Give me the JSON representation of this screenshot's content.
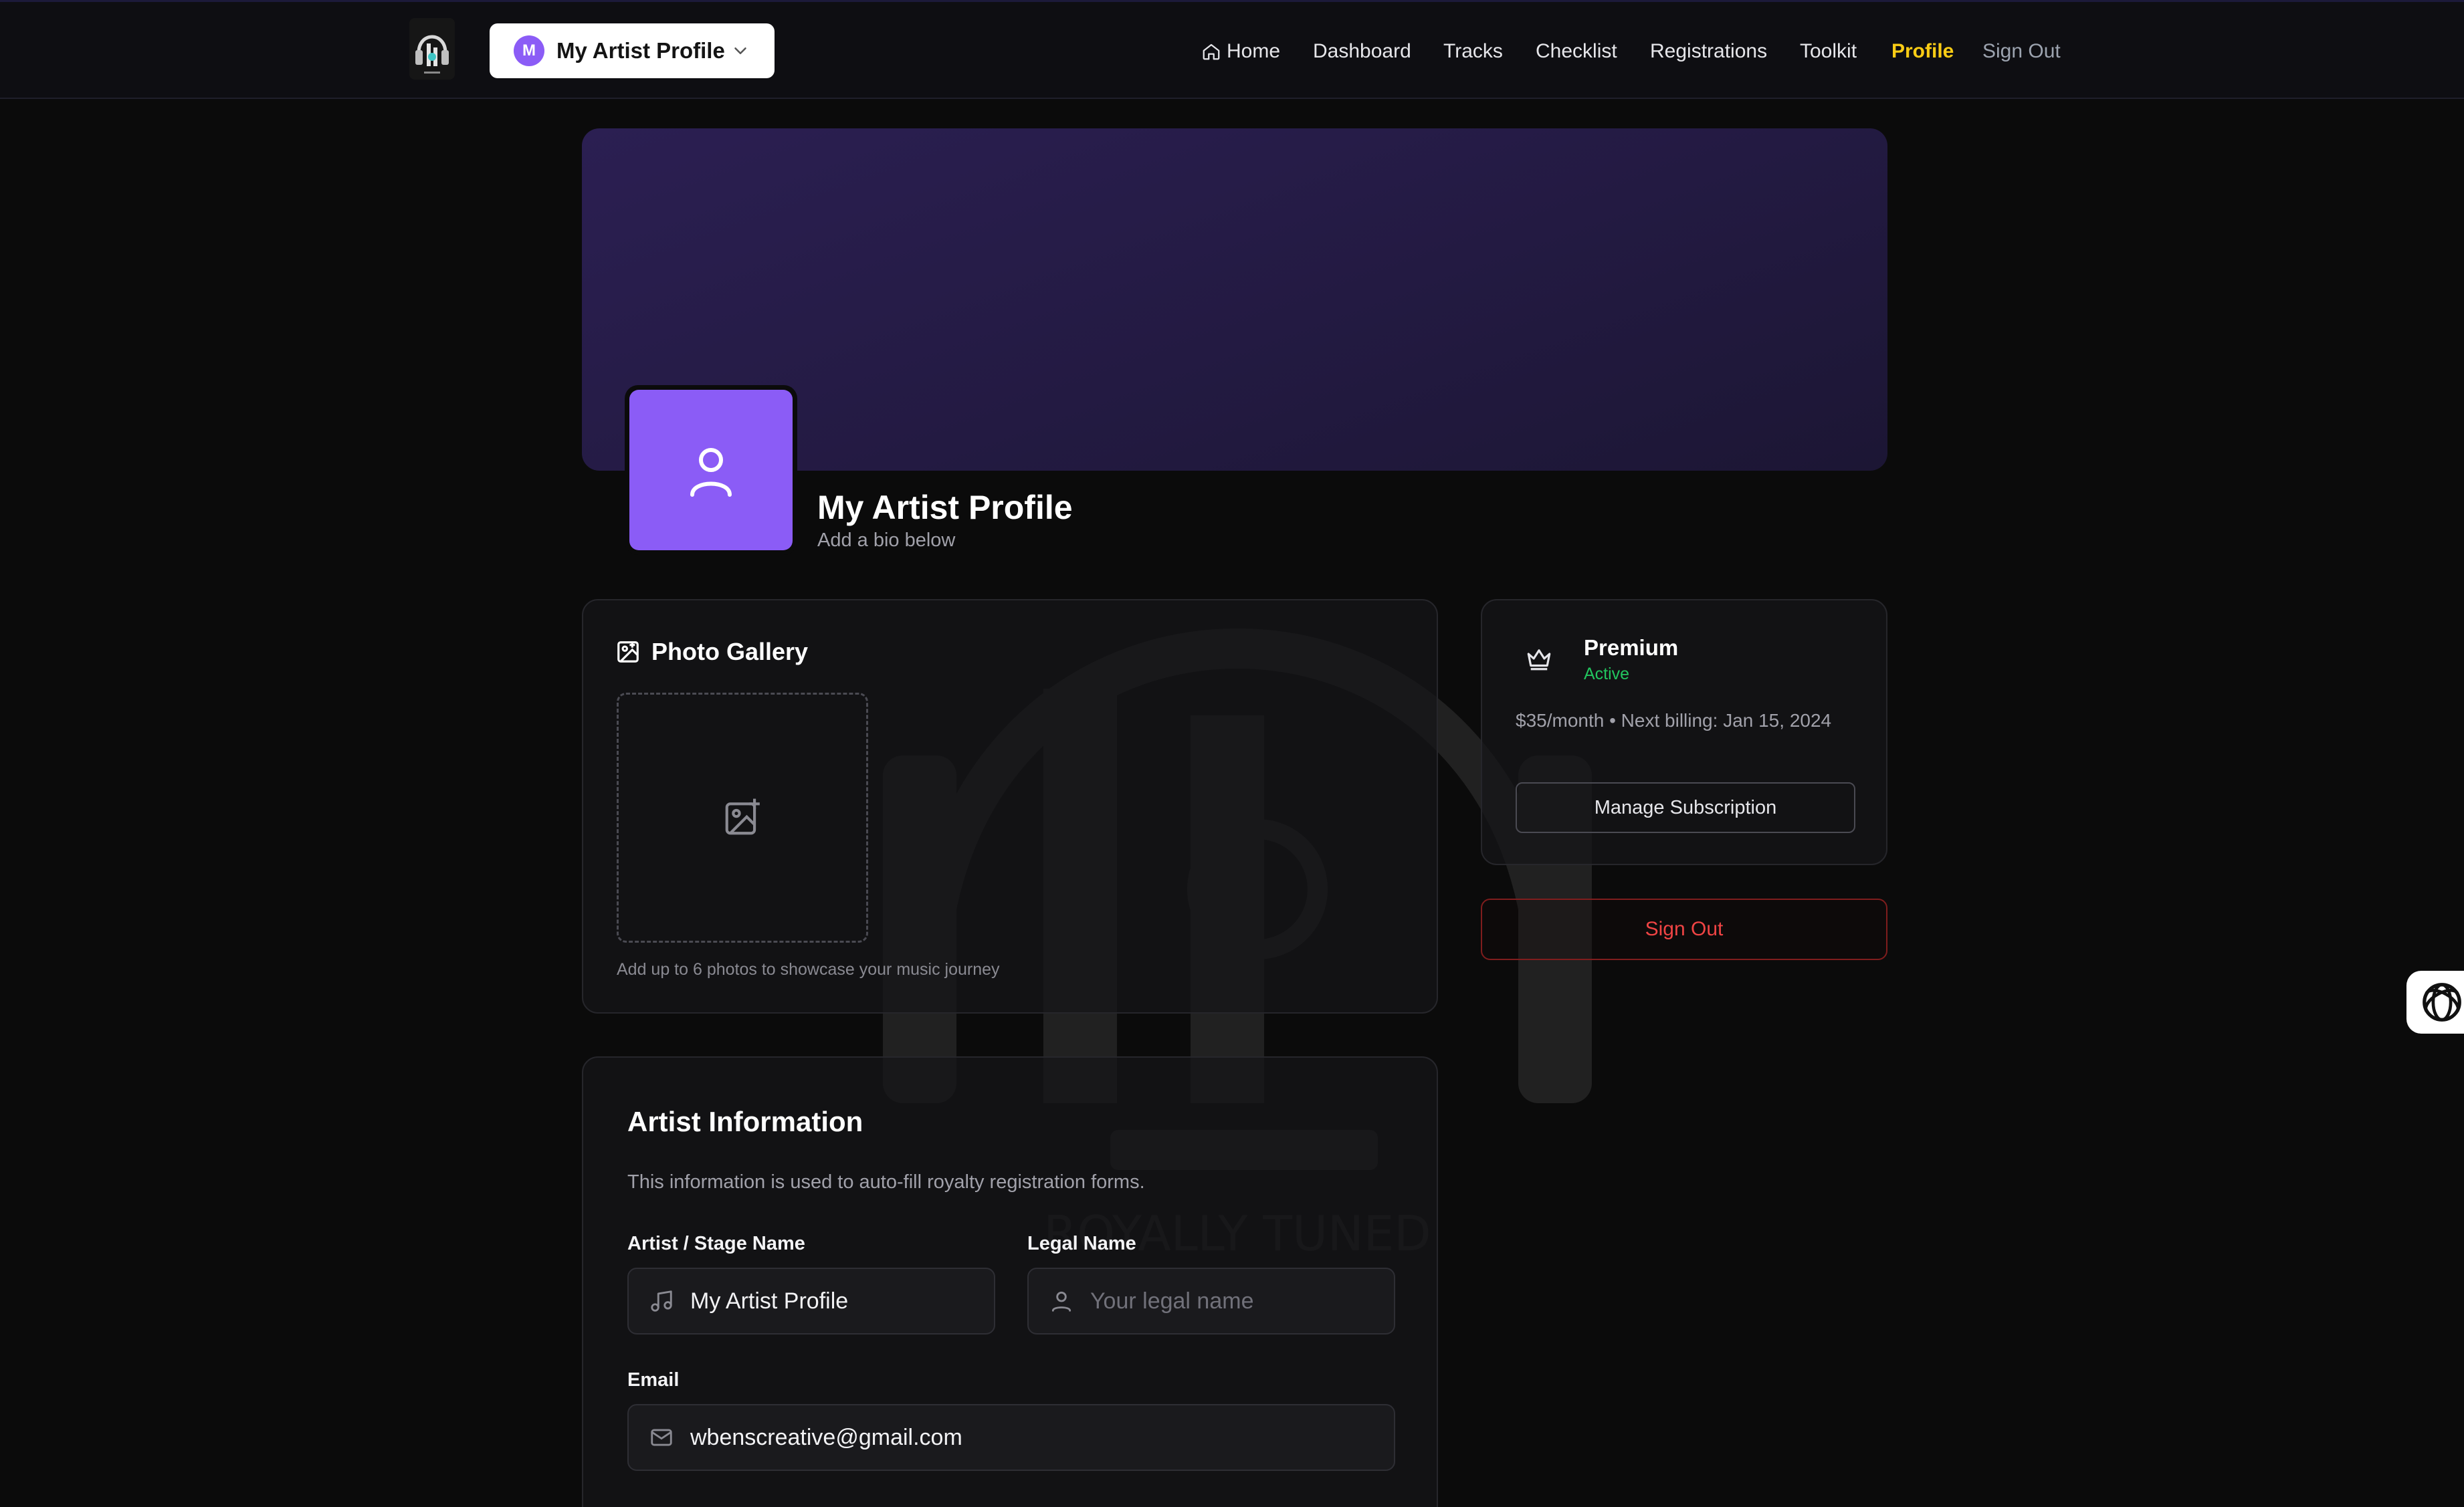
{
  "header": {
    "profile_switcher": {
      "initial": "M",
      "label": "My Artist Profile"
    },
    "nav": [
      {
        "label": "Home",
        "icon": "home-icon"
      },
      {
        "label": "Dashboard"
      },
      {
        "label": "Tracks"
      },
      {
        "label": "Checklist"
      },
      {
        "label": "Registrations"
      },
      {
        "label": "Toolkit"
      },
      {
        "label": "Profile",
        "active": true
      },
      {
        "label": "Sign Out"
      }
    ]
  },
  "profile": {
    "name": "My Artist Profile",
    "bio_placeholder": "Add a bio below"
  },
  "gallery": {
    "title": "Photo Gallery",
    "hint": "Add up to 6 photos to showcase your music journey"
  },
  "subscription": {
    "plan": "Premium",
    "status": "Active",
    "billing": "$35/month • Next billing: Jan 15, 2024",
    "manage_label": "Manage Subscription"
  },
  "sign_out_label": "Sign Out",
  "artist_info": {
    "title": "Artist Information",
    "description": "This information is used to auto-fill royalty registration forms.",
    "stage_name": {
      "label": "Artist / Stage Name",
      "value": "My Artist Profile"
    },
    "legal_name": {
      "label": "Legal Name",
      "placeholder": "Your legal name"
    },
    "email": {
      "label": "Email",
      "value": "wbenscreative@gmail.com"
    }
  },
  "watermark_text": "ROYALLY TUNED",
  "colors": {
    "accent_purple": "#8b5cf6",
    "active_nav": "#facc15",
    "status_active": "#22c55e",
    "danger": "#ef4444",
    "background": "#0b0b0b"
  }
}
